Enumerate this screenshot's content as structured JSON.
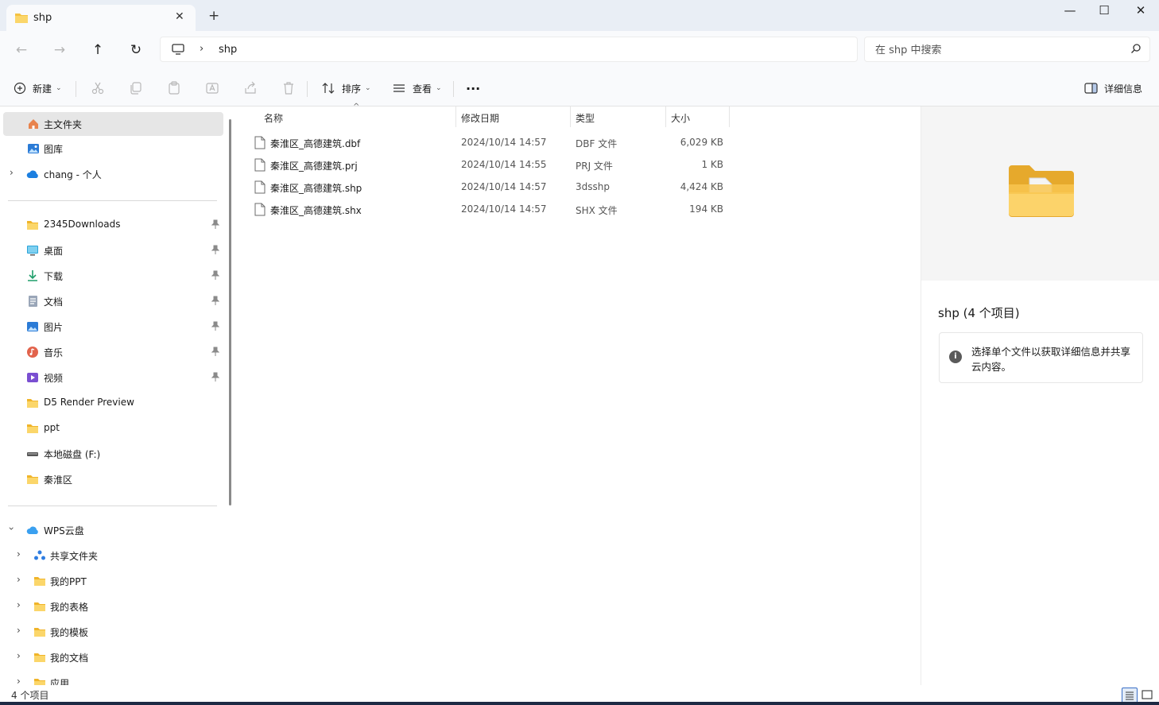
{
  "window": {
    "tab_title": "shp",
    "tab_close": "✕",
    "new_tab": "+",
    "minimize": "—",
    "maximize": "☐",
    "close": "✕"
  },
  "nav": {
    "back": "←",
    "forward": "→",
    "up": "↑",
    "refresh": "↻",
    "separator": "›",
    "breadcrumb": "shp",
    "search_placeholder": "在 shp 中搜索"
  },
  "toolbar": {
    "new_label": "新建",
    "sort_label": "排序",
    "view_label": "查看",
    "more_label": "···",
    "details_label": "详细信息"
  },
  "sidebar": {
    "top_items": [
      {
        "label": "主文件夹",
        "icon": "home-icon"
      },
      {
        "label": "图库",
        "icon": "gallery-icon"
      },
      {
        "label": "chang - 个人",
        "icon": "onedrive-icon"
      }
    ],
    "quick_access": [
      {
        "label": "2345Downloads",
        "icon": "folder-icon",
        "pinned": true
      },
      {
        "label": "桌面",
        "icon": "desktop-icon",
        "pinned": true
      },
      {
        "label": "下载",
        "icon": "download-icon",
        "pinned": true
      },
      {
        "label": "文档",
        "icon": "document-icon",
        "pinned": true
      },
      {
        "label": "图片",
        "icon": "pictures-icon",
        "pinned": true
      },
      {
        "label": "音乐",
        "icon": "music-icon",
        "pinned": true
      },
      {
        "label": "视频",
        "icon": "video-icon",
        "pinned": true
      },
      {
        "label": "D5 Render Preview",
        "icon": "folder-icon",
        "pinned": false
      },
      {
        "label": "ppt",
        "icon": "folder-icon",
        "pinned": false
      },
      {
        "label": "本地磁盘 (F:)",
        "icon": "drive-icon",
        "pinned": false
      },
      {
        "label": "秦淮区",
        "icon": "folder-icon",
        "pinned": false
      }
    ],
    "wps_root": "WPS云盘",
    "wps_items": [
      {
        "label": "共享文件夹",
        "icon": "shared-folder-icon"
      },
      {
        "label": "我的PPT",
        "icon": "folder-icon"
      },
      {
        "label": "我的表格",
        "icon": "folder-icon"
      },
      {
        "label": "我的模板",
        "icon": "folder-icon"
      },
      {
        "label": "我的文档",
        "icon": "folder-icon"
      },
      {
        "label": "应用",
        "icon": "folder-icon"
      }
    ],
    "pin_glyph": "📌"
  },
  "columns": {
    "name": "名称",
    "date": "修改日期",
    "type": "类型",
    "size": "大小"
  },
  "files": [
    {
      "name": "秦淮区_高德建筑.dbf",
      "date": "2024/10/14 14:57",
      "type": "DBF 文件",
      "size": "6,029 KB"
    },
    {
      "name": "秦淮区_高德建筑.prj",
      "date": "2024/10/14 14:55",
      "type": "PRJ 文件",
      "size": "1 KB"
    },
    {
      "name": "秦淮区_高德建筑.shp",
      "date": "2024/10/14 14:57",
      "type": "3dsshp",
      "size": "4,424 KB"
    },
    {
      "name": "秦淮区_高德建筑.shx",
      "date": "2024/10/14 14:57",
      "type": "SHX 文件",
      "size": "194 KB"
    }
  ],
  "details": {
    "title": "shp (4 个项目)",
    "info_glyph": "i",
    "info_text": "选择单个文件以获取详细信息并共享云内容。"
  },
  "status": {
    "count": "4 个项目"
  },
  "colors": {
    "folder": "#f5c242",
    "accent": "#3a6fc7",
    "selected_bg": "#e6e6e6"
  }
}
